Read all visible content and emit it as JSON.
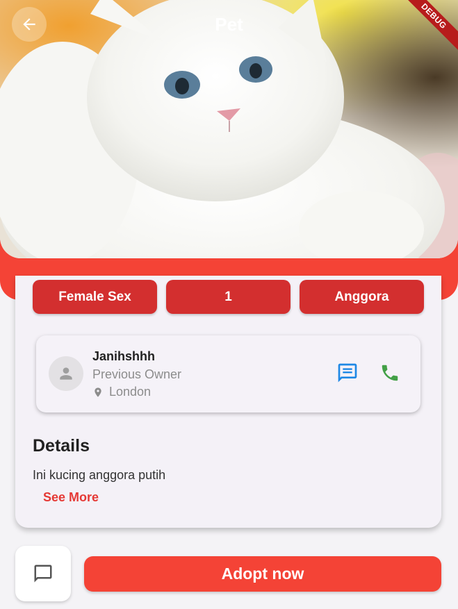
{
  "app": {
    "title": "Pet",
    "debug_banner": "DEBUG"
  },
  "colors": {
    "accent": "#f44336",
    "chip": "#d32f2f",
    "message_icon": "#1e88e5",
    "call_icon": "#43a047"
  },
  "hero": {
    "image": "white-persian-cat-photo"
  },
  "chips": [
    "Female Sex",
    "1",
    "Anggora"
  ],
  "owner": {
    "name": "Janihshhh",
    "role": "Previous Owner",
    "location": "London",
    "message_icon": "message-icon",
    "call_icon": "phone-icon"
  },
  "details": {
    "heading": "Details",
    "text": "Ini kucing anggora putih",
    "see_more": "See More"
  },
  "bottom": {
    "chat_icon": "chat-icon",
    "adopt_label": "Adopt now"
  }
}
